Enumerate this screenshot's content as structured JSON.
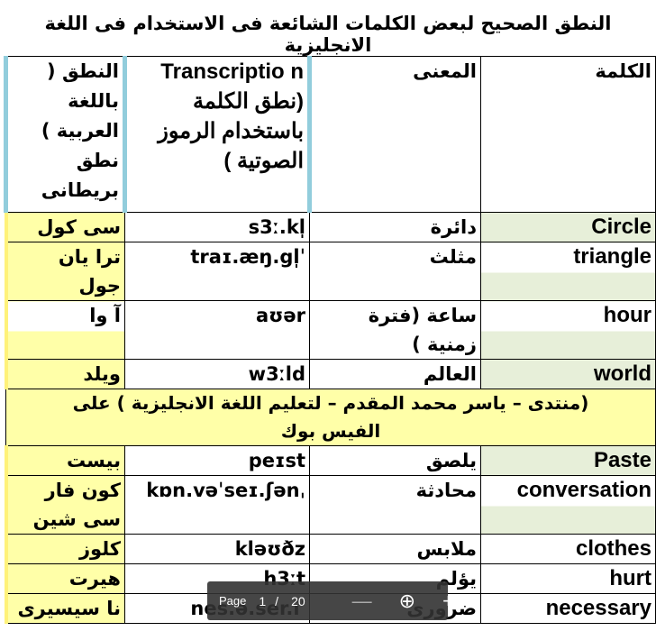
{
  "title": "النطق الصحيح لبعض الكلمات الشائعة فى الاستخدام فى اللغة الانجليزية",
  "headers": {
    "word": "الكلمة",
    "meaning": "المعنى",
    "transcription": "Transcriptio n (نطق الكلمة باستخدام الرموز الصوتية )",
    "arabic_pron": "النطق ( باللغة العربية ) نطق بريطانى"
  },
  "rows1": [
    {
      "word": "Circle",
      "meaning": "دائرة",
      "ipa": "s3ː.kl̩",
      "pron": "سى كول"
    },
    {
      "word": "triangle",
      "meaning": "مثلث",
      "ipa": "ˈtraɪ.æŋ.gl̩",
      "pron": "ترا يان جول"
    },
    {
      "word": "hour",
      "meaning": "ساعة (فترة زمنية )",
      "ipa": "aʊər",
      "pron": "آ وا"
    },
    {
      "word": "world",
      "meaning": "العالم",
      "ipa": "w3ːld",
      "pron": "ويلد"
    }
  ],
  "forum": "(منتدى – ياسر محمد المقدم – لتعليم اللغة الانجليزية ) على الفيس بوك",
  "rows2": [
    {
      "word": "Paste",
      "meaning": "يلصق",
      "ipa": "peɪst",
      "pron": "بيست"
    },
    {
      "word": "conversation",
      "meaning": "محادثة",
      "ipa": "ˌkɒn.vəˈseɪ.ʃən",
      "pron": "كون فار سى شين"
    },
    {
      "word": "clothes",
      "meaning": "ملابس",
      "ipa": "kləʊðz",
      "pron": "كلوز"
    },
    {
      "word": "hurt",
      "meaning": "يؤلم",
      "ipa": "h3ːt",
      "pron": "هيرت"
    },
    {
      "word": "necessary",
      "meaning": "ضرورى",
      "ipa": "ˈnes.ə.ser.i",
      "pron": "نا سيسيرى"
    }
  ],
  "toolbar": {
    "page_label": "Page",
    "current_page": "1",
    "separator": "/",
    "total_pages": "20",
    "zoom_out": "—",
    "zoom_icon": "⊕",
    "zoom_in": "+"
  }
}
